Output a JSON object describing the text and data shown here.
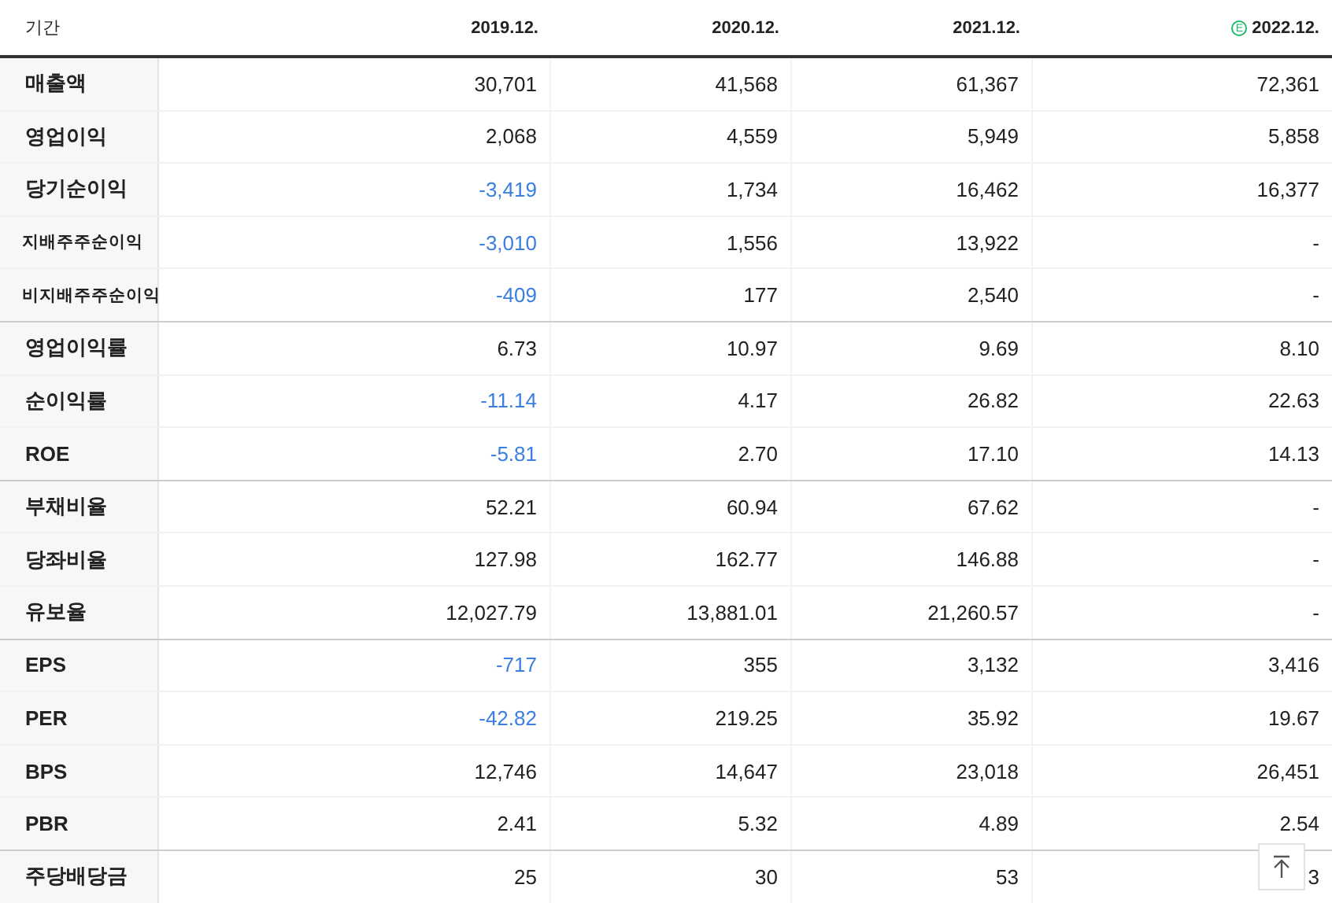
{
  "table": {
    "corner_label": "기간",
    "columns": [
      {
        "label": "2019.12."
      },
      {
        "label": "2020.12."
      },
      {
        "label": "2021.12."
      },
      {
        "label": "2022.12.",
        "badge": "E"
      }
    ],
    "rows": [
      {
        "label": "매출액",
        "kind": "main",
        "group_end": false,
        "cells": [
          {
            "text": "30,701",
            "negative": false
          },
          {
            "text": "41,568",
            "negative": false
          },
          {
            "text": "61,367",
            "negative": false
          },
          {
            "text": "72,361",
            "negative": false
          }
        ]
      },
      {
        "label": "영업이익",
        "kind": "main",
        "group_end": false,
        "cells": [
          {
            "text": "2,068",
            "negative": false
          },
          {
            "text": "4,559",
            "negative": false
          },
          {
            "text": "5,949",
            "negative": false
          },
          {
            "text": "5,858",
            "negative": false
          }
        ]
      },
      {
        "label": "당기순이익",
        "kind": "main",
        "group_end": false,
        "cells": [
          {
            "text": "-3,419",
            "negative": true
          },
          {
            "text": "1,734",
            "negative": false
          },
          {
            "text": "16,462",
            "negative": false
          },
          {
            "text": "16,377",
            "negative": false
          }
        ]
      },
      {
        "label": "지배주주순이익",
        "kind": "sub",
        "group_end": false,
        "cells": [
          {
            "text": "-3,010",
            "negative": true
          },
          {
            "text": "1,556",
            "negative": false
          },
          {
            "text": "13,922",
            "negative": false
          },
          {
            "text": "-",
            "negative": false
          }
        ]
      },
      {
        "label": "비지배주주순이익",
        "kind": "sub",
        "group_end": true,
        "cells": [
          {
            "text": "-409",
            "negative": true
          },
          {
            "text": "177",
            "negative": false
          },
          {
            "text": "2,540",
            "negative": false
          },
          {
            "text": "-",
            "negative": false
          }
        ]
      },
      {
        "label": "영업이익률",
        "kind": "main",
        "group_end": false,
        "cells": [
          {
            "text": "6.73",
            "negative": false
          },
          {
            "text": "10.97",
            "negative": false
          },
          {
            "text": "9.69",
            "negative": false
          },
          {
            "text": "8.10",
            "negative": false
          }
        ]
      },
      {
        "label": "순이익률",
        "kind": "main",
        "group_end": false,
        "cells": [
          {
            "text": "-11.14",
            "negative": true
          },
          {
            "text": "4.17",
            "negative": false
          },
          {
            "text": "26.82",
            "negative": false
          },
          {
            "text": "22.63",
            "negative": false
          }
        ]
      },
      {
        "label": "ROE",
        "kind": "main",
        "group_end": true,
        "cells": [
          {
            "text": "-5.81",
            "negative": true
          },
          {
            "text": "2.70",
            "negative": false
          },
          {
            "text": "17.10",
            "negative": false
          },
          {
            "text": "14.13",
            "negative": false
          }
        ]
      },
      {
        "label": "부채비율",
        "kind": "main",
        "group_end": false,
        "cells": [
          {
            "text": "52.21",
            "negative": false
          },
          {
            "text": "60.94",
            "negative": false
          },
          {
            "text": "67.62",
            "negative": false
          },
          {
            "text": "-",
            "negative": false
          }
        ]
      },
      {
        "label": "당좌비율",
        "kind": "main",
        "group_end": false,
        "cells": [
          {
            "text": "127.98",
            "negative": false
          },
          {
            "text": "162.77",
            "negative": false
          },
          {
            "text": "146.88",
            "negative": false
          },
          {
            "text": "-",
            "negative": false
          }
        ]
      },
      {
        "label": "유보율",
        "kind": "main",
        "group_end": true,
        "cells": [
          {
            "text": "12,027.79",
            "negative": false
          },
          {
            "text": "13,881.01",
            "negative": false
          },
          {
            "text": "21,260.57",
            "negative": false
          },
          {
            "text": "-",
            "negative": false
          }
        ]
      },
      {
        "label": "EPS",
        "kind": "main",
        "group_end": false,
        "cells": [
          {
            "text": "-717",
            "negative": true
          },
          {
            "text": "355",
            "negative": false
          },
          {
            "text": "3,132",
            "negative": false
          },
          {
            "text": "3,416",
            "negative": false
          }
        ]
      },
      {
        "label": "PER",
        "kind": "main",
        "group_end": false,
        "cells": [
          {
            "text": "-42.82",
            "negative": true
          },
          {
            "text": "219.25",
            "negative": false
          },
          {
            "text": "35.92",
            "negative": false
          },
          {
            "text": "19.67",
            "negative": false
          }
        ]
      },
      {
        "label": "BPS",
        "kind": "main",
        "group_end": false,
        "cells": [
          {
            "text": "12,746",
            "negative": false
          },
          {
            "text": "14,647",
            "negative": false
          },
          {
            "text": "23,018",
            "negative": false
          },
          {
            "text": "26,451",
            "negative": false
          }
        ]
      },
      {
        "label": "PBR",
        "kind": "main",
        "group_end": true,
        "cells": [
          {
            "text": "2.41",
            "negative": false
          },
          {
            "text": "5.32",
            "negative": false
          },
          {
            "text": "4.89",
            "negative": false
          },
          {
            "text": "2.54",
            "negative": false
          }
        ]
      },
      {
        "label": "주당배당금",
        "kind": "main",
        "cells": [
          {
            "text": "25",
            "negative": false
          },
          {
            "text": "30",
            "negative": false
          },
          {
            "text": "53",
            "negative": false
          },
          {
            "text": "3",
            "negative": false
          }
        ]
      }
    ]
  }
}
